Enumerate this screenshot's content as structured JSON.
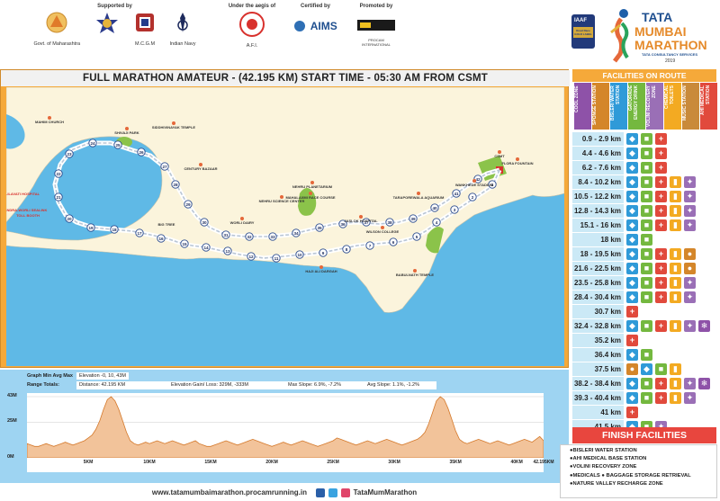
{
  "header": {
    "supported_by": "Supported by",
    "under_aegis": "Under the aegis of",
    "certified_by": "Certified by",
    "promoted_by": "Promoted by",
    "logos": [
      {
        "name": "govt-maharashtra",
        "caption": "Govt. of Maharashtra"
      },
      {
        "name": "police",
        "caption": ""
      },
      {
        "name": "mcgm",
        "caption": "M.C.G.M"
      },
      {
        "name": "indian-navy",
        "caption": "Indian Navy"
      },
      {
        "name": "afi",
        "caption": "A.F.I."
      },
      {
        "name": "aims",
        "caption": "AIMS"
      },
      {
        "name": "procam",
        "caption": "PROCAM INTERNATIONAL"
      }
    ],
    "brand": {
      "iaaf": "IAAF",
      "label_gold": "Road Race GOLD LABEL",
      "tata": "TATA",
      "mumbai": "MUMBAI",
      "marathon": "MARATHON",
      "tcs": "TATA CONSULTANCY SERVICES",
      "year": "2019"
    }
  },
  "map": {
    "title": "FULL MARATHON AMATEUR - (42.195 KM) START TIME - 05:30 AM FROM CSMT",
    "labels": [
      "MAHIM CHURCH",
      "SHIVAJI PARK",
      "SIDDHIVINAYAK TEMPLE",
      "CENTURY BAZAAR",
      "NEHRU SCIENCE CENTER",
      "WORLI DAIRY",
      "NEHRU PLANETARIUM",
      "MAHALAXMI RACE COURSE",
      "HAJI ALI DARGAH",
      "JASLOK HOSPITAL",
      "WILSON COLLEGE",
      "TARAPOREWALA AQUARIUM",
      "BABULNATH TEMPLE",
      "WANKHEDE STADIUM",
      "CSMT",
      "FLORA FOUNTAIN",
      "LILAVATI HOSPITAL",
      "BANDRA-WORLI SEALINK",
      "TOLL BOOTH",
      "BIG TREE"
    ],
    "markers": [
      "1",
      "2",
      "3",
      "4",
      "5",
      "6",
      "7",
      "8",
      "9",
      "10",
      "11",
      "12",
      "13",
      "14",
      "15",
      "16",
      "17",
      "18",
      "19",
      "20",
      "21",
      "22",
      "23",
      "24",
      "25",
      "26",
      "27",
      "28",
      "29",
      "30",
      "31",
      "32",
      "33",
      "34",
      "35",
      "36",
      "37",
      "38",
      "39",
      "40",
      "41",
      "42"
    ]
  },
  "elevation": {
    "stats_label": "Graph Min Avg Max",
    "stats_value": "Elevation -0, 10, 43M",
    "range_totals": "Range Totals:",
    "distance": "Distance: 42.195 KM",
    "gain_loss": "Elevation Gain/ Loss: 329M, -333M",
    "max_slope": "Max Slope: 6.9%, -7.2%",
    "avg_slope": "Avg Slope: 1.1%, -1.2%",
    "y_ticks": [
      "43M",
      "25M",
      "0M"
    ],
    "x_ticks": [
      "5KM",
      "10KM",
      "15KM",
      "20KM",
      "25KM",
      "30KM",
      "35KM",
      "40KM",
      "42.195KM"
    ],
    "profile": [
      10,
      9,
      8,
      8,
      9,
      10,
      9,
      8,
      9,
      10,
      11,
      10,
      9,
      10,
      11,
      12,
      14,
      16,
      20,
      26,
      34,
      41,
      43,
      40,
      34,
      26,
      18,
      12,
      10,
      9,
      10,
      11,
      10,
      11,
      12,
      11,
      10,
      11,
      12,
      11,
      10,
      9,
      10,
      11,
      12,
      10,
      9,
      8,
      8,
      9,
      10,
      11,
      12,
      11,
      10,
      9,
      10,
      11,
      12,
      13,
      12,
      11,
      10,
      9,
      8,
      9,
      10,
      11,
      10,
      9,
      10,
      11,
      12,
      11,
      10,
      9,
      8,
      9,
      10,
      11,
      12,
      14,
      13,
      12,
      11,
      10,
      9,
      10,
      11,
      12,
      11,
      10,
      11,
      12,
      13,
      12,
      11,
      10,
      9,
      10,
      11,
      12,
      13,
      15,
      18,
      24,
      32,
      40,
      43,
      41,
      35,
      27,
      19,
      13,
      11,
      10,
      11,
      12,
      13,
      12,
      11,
      10,
      11,
      12,
      11,
      10,
      9,
      10,
      11,
      12,
      13,
      12,
      11,
      13,
      15,
      12
    ]
  },
  "footer": {
    "website": "www.tatamumbaimarathon.procamrunning.in",
    "handle": "TataMumMarathon"
  },
  "facilities": {
    "heading": "FACILITIES ON ROUTE",
    "columns": [
      {
        "label": "COOL ZONE",
        "color": "#8e52a8"
      },
      {
        "label": "SPONGE STATION",
        "color": "#d4862a"
      },
      {
        "label": "BISLERI WATER STATION",
        "color": "#2f9ad8"
      },
      {
        "label": "GATORADE ENERGY DRINK",
        "color": "#74b83f"
      },
      {
        "label": "VOLINI RECOVERY ZONE",
        "color": "#9a6fb6"
      },
      {
        "label": "CHEMICAL TOILETS",
        "color": "#f3aa22"
      },
      {
        "label": "MUSIC STATION",
        "color": "#c98a3a"
      },
      {
        "label": "AHI MEDICAL STATION",
        "color": "#e14a3c"
      }
    ],
    "rows": [
      {
        "km": "0.9 - 2.9 km",
        "icons": [
          "water",
          "gatorade",
          "medical"
        ]
      },
      {
        "km": "4.4 - 4.6 km",
        "icons": [
          "water",
          "gatorade",
          "medical"
        ]
      },
      {
        "km": "6.2 - 7.6 km",
        "icons": [
          "water",
          "gatorade",
          "medical"
        ]
      },
      {
        "km": "8.4 - 10.2 km",
        "icons": [
          "water",
          "gatorade",
          "medical",
          "toilet",
          "volini"
        ]
      },
      {
        "km": "10.5 - 12.2 km",
        "icons": [
          "water",
          "gatorade",
          "medical",
          "toilet",
          "volini"
        ]
      },
      {
        "km": "12.8 - 14.3 km",
        "icons": [
          "water",
          "gatorade",
          "medical",
          "toilet",
          "volini"
        ]
      },
      {
        "km": "15.1 - 16 km",
        "icons": [
          "water",
          "gatorade",
          "medical",
          "toilet",
          "volini"
        ]
      },
      {
        "km": "18 km",
        "icons": [
          "water",
          "gatorade"
        ]
      },
      {
        "km": "18 - 19.5 km",
        "icons": [
          "water",
          "gatorade",
          "medical",
          "toilet",
          "sponge"
        ]
      },
      {
        "km": "21.6 - 22.5 km",
        "icons": [
          "water",
          "gatorade",
          "medical",
          "toilet",
          "sponge"
        ]
      },
      {
        "km": "23.5 - 25.8 km",
        "icons": [
          "water",
          "gatorade",
          "medical",
          "toilet",
          "volini"
        ]
      },
      {
        "km": "28.4 - 30.4 km",
        "icons": [
          "water",
          "gatorade",
          "medical",
          "toilet",
          "volini"
        ]
      },
      {
        "km": "30.7 km",
        "icons": [
          "medical"
        ]
      },
      {
        "km": "32.4 - 32.8 km",
        "icons": [
          "water",
          "gatorade",
          "medical",
          "toilet",
          "volini",
          "cool"
        ]
      },
      {
        "km": "35.2 km",
        "icons": [
          "medical"
        ]
      },
      {
        "km": "36.4 km",
        "icons": [
          "water",
          "gatorade"
        ]
      },
      {
        "km": "37.5 km",
        "icons": [
          "sponge",
          "water",
          "gatorade",
          "toilet"
        ]
      },
      {
        "km": "38.2 - 38.4 km",
        "icons": [
          "water",
          "gatorade",
          "medical",
          "toilet",
          "volini",
          "cool"
        ]
      },
      {
        "km": "39.3 - 40.4 km",
        "icons": [
          "water",
          "gatorade",
          "medical",
          "toilet",
          "volini"
        ]
      },
      {
        "km": "41 km",
        "icons": [
          "medical"
        ]
      },
      {
        "km": "41.5 km",
        "icons": [
          "water",
          "gatorade",
          "volini"
        ]
      }
    ],
    "finish_heading": "FINISH FACILITIES",
    "finish_items": [
      "BISLERI WATER STATION",
      "AHI MEDICAL BASE STATION",
      "VOLINI RECOVERY ZONE",
      "MEDICALS  ● BAGGAGE STORAGE RETRIEVAL",
      "NATURE VALLEY RECHARGE ZONE"
    ],
    "icon_colors": {
      "water": "#2f9ad8",
      "gatorade": "#74b83f",
      "medical": "#e14a3c",
      "toilet": "#f3aa22",
      "volini": "#9a6fb6",
      "sponge": "#d4862a",
      "cool": "#8e52a8"
    }
  }
}
